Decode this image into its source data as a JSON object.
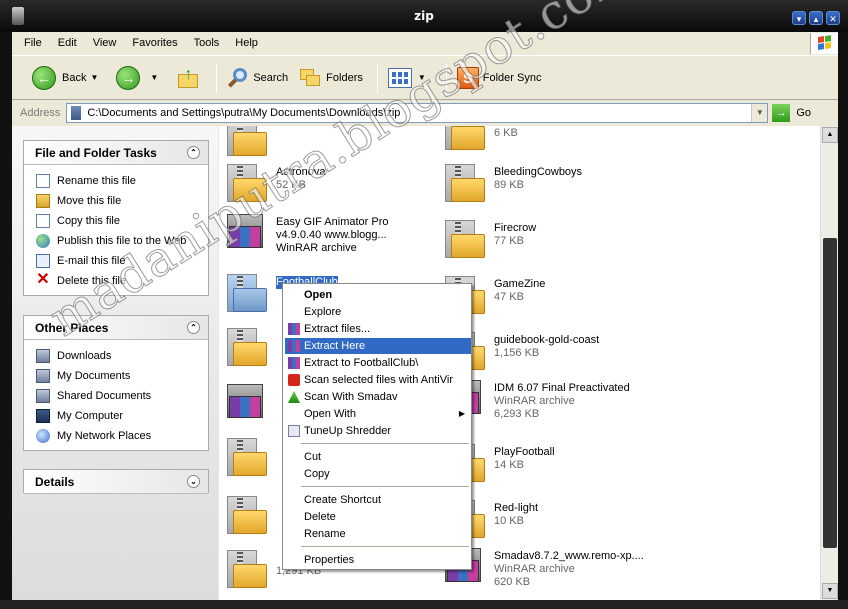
{
  "window": {
    "title": "zip"
  },
  "menu": [
    "File",
    "Edit",
    "View",
    "Favorites",
    "Tools",
    "Help"
  ],
  "toolbar": {
    "back": "Back",
    "search": "Search",
    "folders": "Folders",
    "folder_sync": "Folder Sync"
  },
  "address": {
    "label": "Address",
    "path": "C:\\Documents and Settings\\putra\\My Documents\\Downloads\\zip",
    "go": "Go"
  },
  "file_tasks": {
    "title": "File and Folder Tasks",
    "items": [
      "Rename this file",
      "Move this file",
      "Copy this file",
      "Publish this file to the Web",
      "E-mail this file",
      "Delete this file"
    ]
  },
  "other_places": {
    "title": "Other Places",
    "items": [
      "Downloads",
      "My Documents",
      "Shared Documents",
      "My Computer",
      "My Network Places"
    ]
  },
  "details": {
    "title": "Details"
  },
  "files_left": [
    {
      "name": "Astronova",
      "line2": "52 KB"
    },
    {
      "name": "Easy GIF Animator Pro",
      "line2": "v4.9.0.40 www.blogg...",
      "line3": "WinRAR archive"
    },
    {
      "name": "FootballClub",
      "line2": ""
    },
    {
      "name": "",
      "line2": ""
    },
    {
      "name": "",
      "line2": ""
    },
    {
      "name": "",
      "line2": ""
    },
    {
      "name": "",
      "line2": ""
    },
    {
      "name": "",
      "line2": "1,291 KB"
    }
  ],
  "files_right": [
    {
      "name": "",
      "line2": "6 KB"
    },
    {
      "name": "BleedingCowboys",
      "line2": "89 KB"
    },
    {
      "name": "Firecrow",
      "line2": "77 KB"
    },
    {
      "name": "GameZine",
      "line2": "47 KB"
    },
    {
      "name": "guidebook-gold-coast",
      "line2": "1,156 KB"
    },
    {
      "name": "IDM 6.07 Final Preactivated",
      "line2": "WinRAR archive",
      "line3": "6,293 KB"
    },
    {
      "name": "PlayFootball",
      "line2": "14 KB"
    },
    {
      "name": "Red-light",
      "line2": "10 KB"
    },
    {
      "name": "Smadav8.7.2_www.remo-xp....",
      "line2": "WinRAR archive",
      "line3": "620 KB"
    }
  ],
  "context_menu": {
    "open": "Open",
    "explore": "Explore",
    "extract_files": "Extract files...",
    "extract_here": "Extract Here",
    "extract_to": "Extract to FootballClub\\",
    "scan_antivir": "Scan selected files with AntiVir",
    "scan_smadav": "Scan With Smadav",
    "open_with": "Open With",
    "tuneup": "TuneUp Shredder",
    "cut": "Cut",
    "copy": "Copy",
    "create_shortcut": "Create Shortcut",
    "delete": "Delete",
    "rename": "Rename",
    "properties": "Properties"
  },
  "watermark": "madaniputra.blogspot.com",
  "colors": {
    "selection": "#316ac5",
    "face": "#ece9d8"
  }
}
